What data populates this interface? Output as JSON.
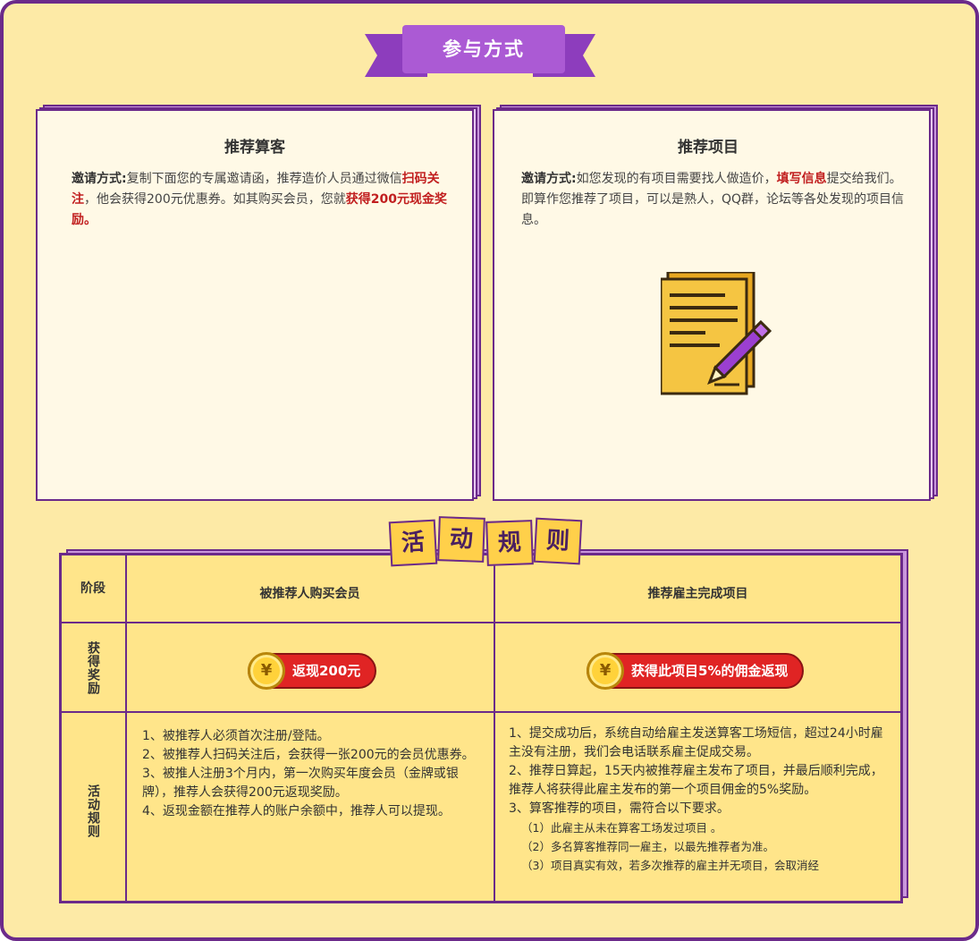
{
  "header": {
    "title": "参与方式"
  },
  "cards": [
    {
      "title": "推荐算客",
      "label": "邀请方式:",
      "text1": "复制下面您的专属邀请函，推荐造价人员通过微信",
      "hl1": "扫码关注",
      "text2": "，他会获得200元优惠券。如其购买会员，您就",
      "hl2": "获得200元现金奖励。"
    },
    {
      "title": "推荐项目",
      "label": "邀请方式:",
      "text1": "如您发现的有项目需要找人做造价，",
      "hl1": "填写信息",
      "text2": "提交给我们。即算作您推荐了项目，可以是熟人，QQ群，论坛等各处发现的项目信息。",
      "icon": "document-pencil-icon"
    }
  ],
  "rules_title": [
    "活",
    "动",
    "规",
    "则"
  ],
  "table": {
    "col0_header": "阶段",
    "col1_header": "被推荐人购买会员",
    "col2_header": "推荐雇主完成项目",
    "reward_label": "获得奖励",
    "rules_label": "活动规则",
    "coin_symbol": "¥",
    "reward1": "返现200元",
    "reward2": "获得此项目5%的佣金返现",
    "rules1": [
      "1、被推荐人必须首次注册/登陆。",
      "2、被推荐人扫码关注后，会获得一张200元的会员优惠券。",
      "3、被推人注册3个月内，第一次购买年度会员（金牌或银牌），推荐人会获得200元返现奖励。",
      "4、返现金额在推荐人的账户余额中，推荐人可以提现。"
    ],
    "rules2": [
      "1、提交成功后，系统自动给雇主发送算客工场短信，超过24小时雇主没有注册，我们会电话联系雇主促成交易。",
      "2、推荐日算起，15天内被推荐雇主发布了项目，并最后顺利完成，推荐人将获得此雇主发布的第一个项目佣金的5%奖励。",
      "3、算客推荐的项目，需符合以下要求。"
    ],
    "rules2_sub": [
      "（1）此雇主从未在算客工场发过项目 。",
      "（2）多名算客推荐同一雇主，以最先推荐者为准。",
      "（3）项目真实有效，若多次推荐的雇主并无项目，会取消经"
    ]
  }
}
